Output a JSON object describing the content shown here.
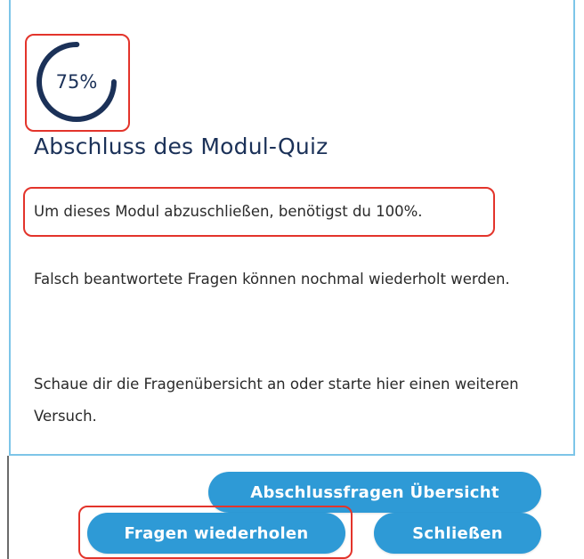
{
  "progress": {
    "value": 0.75,
    "label": "75%",
    "color": "#1b3158"
  },
  "quiz": {
    "title": "Abschluss des Modul-Quiz",
    "requirement": "Um dieses Modul abzuschließen, benötigst du 100%.",
    "retry_info": "Falsch beantwortete Fragen können nochmal wiederholt werden.",
    "overview_info": "Schaue dir die Fragenübersicht an oder starte hier einen weiteren Versuch."
  },
  "buttons": {
    "overview": "Abschlussfragen Übersicht",
    "retry": "Fragen wiederholen",
    "close": "Schließen"
  },
  "colors": {
    "accent": "#2e9ad6",
    "highlight": "#e3342b",
    "border": "#7dc5e8"
  }
}
